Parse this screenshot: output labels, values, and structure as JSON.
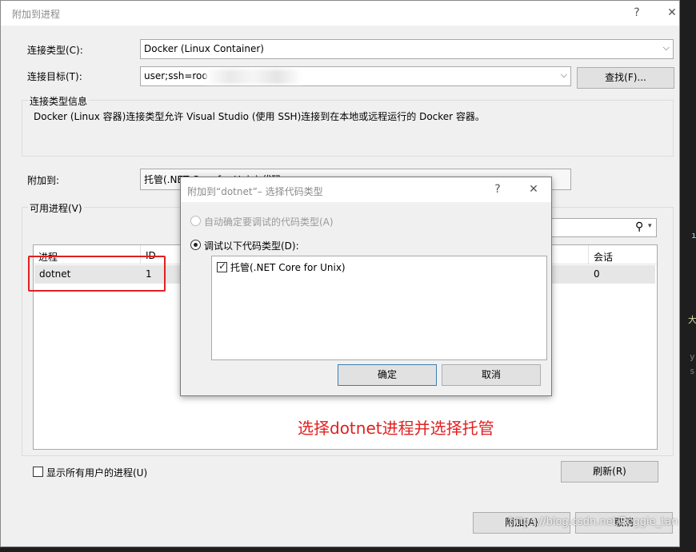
{
  "main": {
    "title": "附加到进程",
    "help_glyph": "?",
    "close_glyph": "✕",
    "connection_type_label": "连接类型(C):",
    "connection_type_value": "Docker (Linux Container)",
    "connection_target_label": "连接目标(T):",
    "connection_target_value": "user;ssh=roo",
    "find_button": "查找(F)...",
    "info_group_title": "连接类型信息",
    "info_text": "Docker (Linux 容器)连接类型允许 Visual Studio (使用 SSH)连接到在本地或远程运行的 Docker 容器。",
    "attach_to_label": "附加到:",
    "attach_to_value": "托管(.NET Core for Unix) 代码",
    "available_group_title": "可用进程(V)",
    "columns": [
      "进程",
      "ID",
      "会话"
    ],
    "rows": [
      {
        "process": "dotnet",
        "id": "1",
        "session": "0"
      }
    ],
    "show_all_users_label": "显示所有用户的进程(U)",
    "refresh_button": "刷新(R)",
    "attach_button": "附加(A)",
    "cancel_button": "取消",
    "search_icon_glyph": "⚲",
    "search_dropdown_glyph": "▾"
  },
  "sub_dialog": {
    "title": "附加到“dotnet”– 选择代码类型",
    "help_glyph": "?",
    "close_glyph": "✕",
    "auto_radio_label": "自动确定要调试的代码类型(A)",
    "debug_radio_label": "调试以下代码类型(D):",
    "code_types": [
      {
        "label": "托管(.NET Core for Unix)",
        "checked": true
      }
    ],
    "ok_button": "确定",
    "cancel_button": "取消"
  },
  "annotation": {
    "note": "选择dotnet进程并选择托管",
    "color": "#e02020"
  },
  "watermark": "https://blog.csdn.net/Reggie_tan",
  "chevron_glyph": "⌵"
}
